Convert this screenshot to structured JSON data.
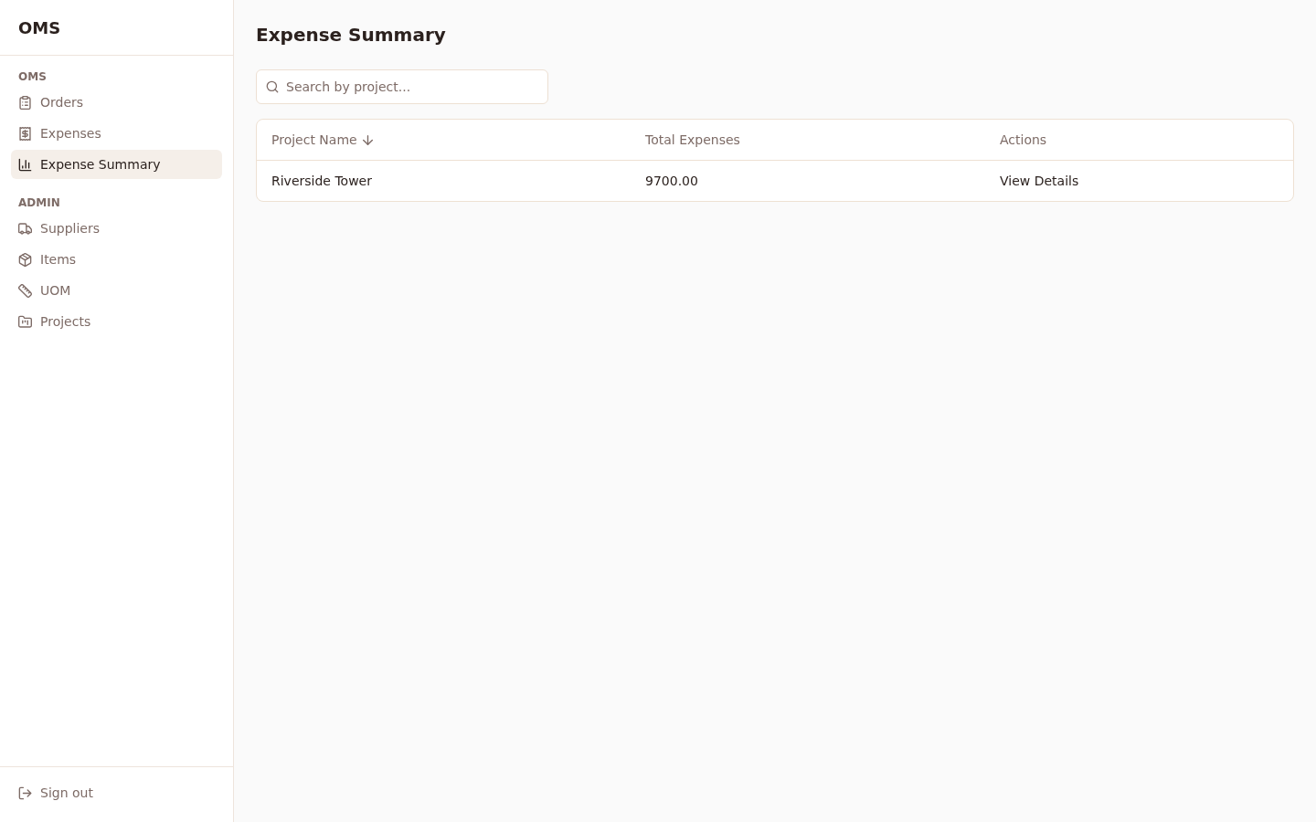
{
  "sidebar": {
    "logo": "OMS",
    "sections": [
      {
        "heading": "OMS",
        "items": [
          {
            "label": "Orders",
            "selected": false
          },
          {
            "label": "Expenses",
            "selected": false
          },
          {
            "label": "Expense Summary",
            "selected": true
          }
        ]
      },
      {
        "heading": "ADMIN",
        "items": [
          {
            "label": "Suppliers",
            "selected": false
          },
          {
            "label": "Items",
            "selected": false
          },
          {
            "label": "UOM",
            "selected": false
          },
          {
            "label": "Projects",
            "selected": false
          }
        ]
      }
    ],
    "footer": {
      "label": "Sign out"
    }
  },
  "main": {
    "title": "Expense Summary",
    "search": {
      "placeholder": "Search by project..."
    },
    "table": {
      "columns": [
        {
          "label": "Project Name",
          "sorted": true
        },
        {
          "label": "Total Expenses",
          "sorted": false
        },
        {
          "label": "Actions",
          "sorted": false
        }
      ],
      "rows": [
        {
          "project": "Riverside Tower",
          "total": "9700.00",
          "action": "View Details"
        }
      ]
    }
  }
}
